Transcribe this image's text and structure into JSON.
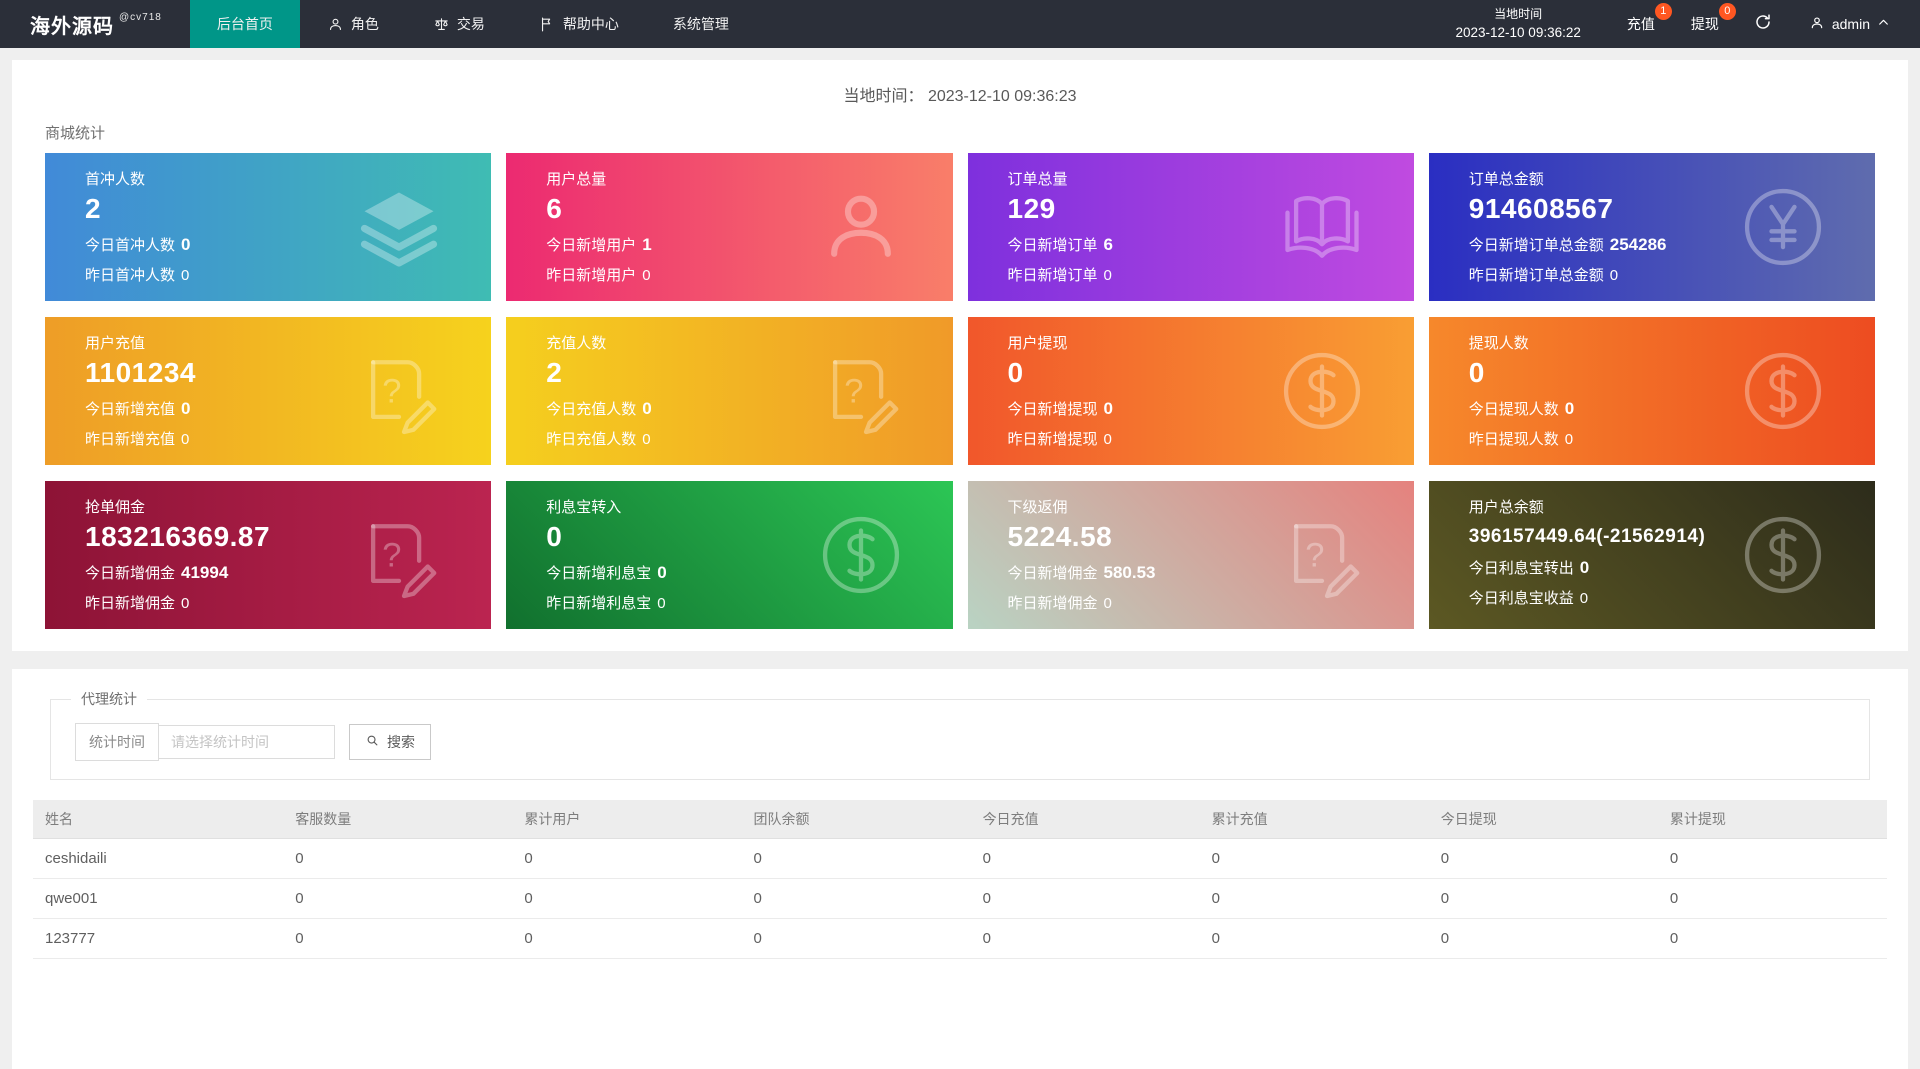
{
  "navbar": {
    "brand": "海外源码",
    "brand_sub": "@cv718",
    "items": [
      {
        "name": "home",
        "label": "后台首页",
        "active": true
      },
      {
        "name": "roles",
        "label": "角色",
        "icon": "user-icon"
      },
      {
        "name": "trade",
        "label": "交易",
        "icon": "scales-icon"
      },
      {
        "name": "help-center",
        "label": "帮助中心",
        "icon": "flag-icon"
      },
      {
        "name": "system",
        "label": "系统管理"
      }
    ],
    "local_time_label": "当地时间",
    "local_time_value": "2023-12-10 09:36:22",
    "recharge_label": "充值",
    "recharge_badge": "1",
    "withdraw_label": "提现",
    "withdraw_badge": "0",
    "badge_color": "#ff5722",
    "active_tab_color": "#009688",
    "user_name": "admin"
  },
  "overview": {
    "local_time_label": "当地时间：",
    "local_time_value": "2023-12-10 09:36:23",
    "section_title": "商城统计",
    "cards": [
      {
        "title": "首冲人数",
        "value": "2",
        "line1_label": "今日首冲人数",
        "line1_value": "0",
        "line2_label": "昨日首冲人数",
        "line2_value": "0",
        "icon": "layers-icon",
        "gradient": {
          "angle": "90deg",
          "from": "#418ad8",
          "to": "#3fbcb3"
        }
      },
      {
        "title": "用户总量",
        "value": "6",
        "line1_label": "今日新增用户",
        "line1_value": "1",
        "line2_label": "昨日新增用户",
        "line2_value": "0",
        "icon": "user-icon",
        "gradient": {
          "angle": "90deg",
          "from": "#ec2a71",
          "to": "#f97e69"
        }
      },
      {
        "title": "订单总量",
        "value": "129",
        "line1_label": "今日新增订单",
        "line1_value": "6",
        "line2_label": "昨日新增订单",
        "line2_value": "0",
        "icon": "book-icon",
        "gradient": {
          "angle": "90deg",
          "from": "#7e30dd",
          "to": "#c04be0"
        }
      },
      {
        "title": "订单总金额",
        "value": "914608567",
        "line1_label": "今日新增订单总金额",
        "line1_value": "254286",
        "line2_label": "昨日新增订单总金额",
        "line2_value": "0",
        "icon": "yen-coin-icon",
        "gradient": {
          "angle": "90deg",
          "from": "#2a2ec2",
          "to": "#5f6cae"
        }
      },
      {
        "title": "用户充值",
        "value": "1101234",
        "line1_label": "今日新增充值",
        "line1_value": "0",
        "line2_label": "昨日新增充值",
        "line2_value": "0",
        "icon": "doc-edit-icon",
        "gradient": {
          "angle": "90deg",
          "from": "#ee9d27",
          "to": "#f6d21d"
        }
      },
      {
        "title": "充值人数",
        "value": "2",
        "line1_label": "今日充值人数",
        "line1_value": "0",
        "line2_label": "昨日充值人数",
        "line2_value": "0",
        "icon": "doc-edit-icon",
        "gradient": {
          "angle": "90deg",
          "from": "#f5cf1e",
          "to": "#f09a29"
        }
      },
      {
        "title": "用户提现",
        "value": "0",
        "line1_label": "今日新增提现",
        "line1_value": "0",
        "line2_label": "昨日新增提现",
        "line2_value": "0",
        "icon": "dollar-coin-icon",
        "gradient": {
          "angle": "90deg",
          "from": "#f1572b",
          "to": "#f99e33"
        }
      },
      {
        "title": "提现人数",
        "value": "0",
        "line1_label": "今日提现人数",
        "line1_value": "0",
        "line2_label": "昨日提现人数",
        "line2_value": "0",
        "icon": "dollar-coin-icon",
        "gradient": {
          "angle": "90deg",
          "from": "#f6882b",
          "to": "#ed4c21"
        }
      },
      {
        "title": "抢单佣金",
        "value": "183216369.87",
        "line1_label": "今日新增佣金",
        "line1_value": "41994",
        "line2_label": "昨日新增佣金",
        "line2_value": "0",
        "icon": "doc-edit-icon",
        "gradient": {
          "angle": "90deg",
          "from": "#8d1336",
          "to": "#bb2450"
        }
      },
      {
        "title": "利息宝转入",
        "value": "0",
        "line1_label": "今日新增利息宝",
        "line1_value": "0",
        "line2_label": "昨日新增利息宝",
        "line2_value": "0",
        "icon": "dollar-coin-icon",
        "gradient": {
          "angle": "45deg",
          "from": "#11702e",
          "to": "#2cc655"
        }
      },
      {
        "title": "下级返佣",
        "value": "5224.58",
        "line1_label": "今日新增佣金",
        "line1_value": "580.53",
        "line2_label": "昨日新增佣金",
        "line2_value": "0",
        "icon": "doc-edit-icon",
        "gradient": {
          "angle": "45deg",
          "from": "#b9d3c3",
          "to": "#e5827e"
        }
      },
      {
        "title": "用户总余额",
        "value": "396157449.64(-21562914)",
        "line1_label": "今日利息宝转出",
        "line1_value": "0",
        "line2_label": "今日利息宝收益",
        "line2_value": "0",
        "icon": "dollar-coin-icon",
        "gradient": {
          "angle": "45deg",
          "from": "#5c5823",
          "to": "#2d2c1b"
        }
      }
    ]
  },
  "agent": {
    "legend": "代理统计",
    "filter_label": "统计时间",
    "filter_placeholder": "请选择统计时间",
    "search_label": "搜索",
    "search_icon": "search-icon",
    "table": {
      "headers": [
        "姓名",
        "客服数量",
        "累计用户",
        "团队余额",
        "今日充值",
        "累计充值",
        "今日提现",
        "累计提现"
      ],
      "rows": [
        [
          "ceshidaili",
          "0",
          "0",
          "0",
          "0",
          "0",
          "0",
          "0"
        ],
        [
          "qwe001",
          "0",
          "0",
          "0",
          "0",
          "0",
          "0",
          "0"
        ],
        [
          "123777",
          "0",
          "0",
          "0",
          "0",
          "0",
          "0",
          "0"
        ]
      ]
    }
  }
}
